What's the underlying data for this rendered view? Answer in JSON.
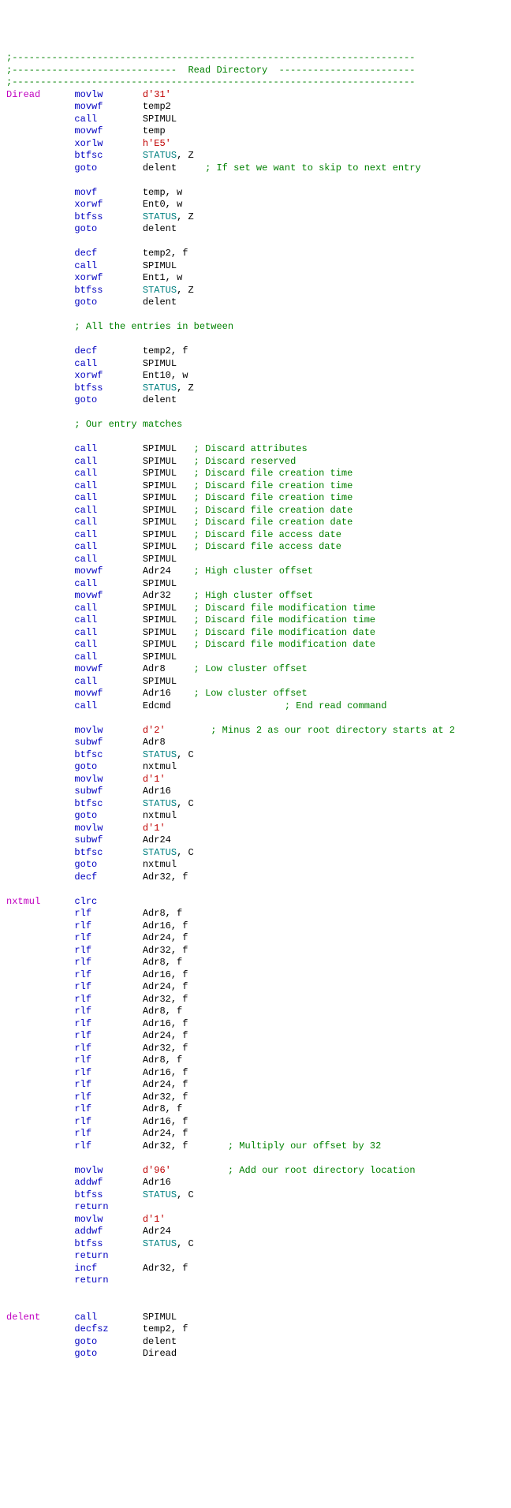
{
  "lines": [
    {
      "type": "comment",
      "text": ";-----------------------------------------------------------------------"
    },
    {
      "type": "comment",
      "text": ";-----------------------------  Read Directory  ------------------------"
    },
    {
      "type": "comment",
      "text": ";-----------------------------------------------------------------------"
    },
    {
      "label": "Diread",
      "mnemonic": "movlw",
      "operands": [
        {
          "cls": "lit",
          "text": "d'31'"
        }
      ]
    },
    {
      "mnemonic": "movwf",
      "operands": [
        {
          "cls": "pln",
          "text": "temp2"
        }
      ]
    },
    {
      "mnemonic": "call",
      "operands": [
        {
          "cls": "pln",
          "text": "SPIMUL"
        }
      ]
    },
    {
      "mnemonic": "movwf",
      "operands": [
        {
          "cls": "pln",
          "text": "temp"
        }
      ]
    },
    {
      "mnemonic": "xorlw",
      "operands": [
        {
          "cls": "lit",
          "text": "h'E5'"
        }
      ]
    },
    {
      "mnemonic": "btfsc",
      "operands": [
        {
          "cls": "reg",
          "text": "STATUS"
        },
        {
          "cls": "pln",
          "text": ", "
        },
        {
          "cls": "pln",
          "text": "Z"
        }
      ]
    },
    {
      "mnemonic": "goto",
      "operands": [
        {
          "cls": "pln",
          "text": "delent"
        }
      ],
      "comment": "     ; If set we want to skip to next entry"
    },
    {
      "type": "blank"
    },
    {
      "mnemonic": "movf",
      "operands": [
        {
          "cls": "pln",
          "text": "temp, w"
        }
      ]
    },
    {
      "mnemonic": "xorwf",
      "operands": [
        {
          "cls": "pln",
          "text": "Ent0, w"
        }
      ]
    },
    {
      "mnemonic": "btfss",
      "operands": [
        {
          "cls": "reg",
          "text": "STATUS"
        },
        {
          "cls": "pln",
          "text": ", "
        },
        {
          "cls": "pln",
          "text": "Z"
        }
      ]
    },
    {
      "mnemonic": "goto",
      "operands": [
        {
          "cls": "pln",
          "text": "delent"
        }
      ]
    },
    {
      "type": "blank"
    },
    {
      "mnemonic": "decf",
      "operands": [
        {
          "cls": "pln",
          "text": "temp2, f"
        }
      ]
    },
    {
      "mnemonic": "call",
      "operands": [
        {
          "cls": "pln",
          "text": "SPIMUL"
        }
      ]
    },
    {
      "mnemonic": "xorwf",
      "operands": [
        {
          "cls": "pln",
          "text": "Ent1, w"
        }
      ]
    },
    {
      "mnemonic": "btfss",
      "operands": [
        {
          "cls": "reg",
          "text": "STATUS"
        },
        {
          "cls": "pln",
          "text": ", "
        },
        {
          "cls": "pln",
          "text": "Z"
        }
      ]
    },
    {
      "mnemonic": "goto",
      "operands": [
        {
          "cls": "pln",
          "text": "delent"
        }
      ]
    },
    {
      "type": "blank"
    },
    {
      "type": "comment",
      "text": "            ; All the entries in between"
    },
    {
      "type": "blank"
    },
    {
      "mnemonic": "decf",
      "operands": [
        {
          "cls": "pln",
          "text": "temp2, f"
        }
      ]
    },
    {
      "mnemonic": "call",
      "operands": [
        {
          "cls": "pln",
          "text": "SPIMUL"
        }
      ]
    },
    {
      "mnemonic": "xorwf",
      "operands": [
        {
          "cls": "pln",
          "text": "Ent10, w"
        }
      ]
    },
    {
      "mnemonic": "btfss",
      "operands": [
        {
          "cls": "reg",
          "text": "STATUS"
        },
        {
          "cls": "pln",
          "text": ", "
        },
        {
          "cls": "pln",
          "text": "Z"
        }
      ]
    },
    {
      "mnemonic": "goto",
      "operands": [
        {
          "cls": "pln",
          "text": "delent"
        }
      ]
    },
    {
      "type": "blank"
    },
    {
      "type": "comment",
      "text": "            ; Our entry matches"
    },
    {
      "type": "blank"
    },
    {
      "mnemonic": "call",
      "operands": [
        {
          "cls": "pln",
          "text": "SPIMUL"
        }
      ],
      "comment": "   ; Discard attributes"
    },
    {
      "mnemonic": "call",
      "operands": [
        {
          "cls": "pln",
          "text": "SPIMUL"
        }
      ],
      "comment": "   ; Discard reserved"
    },
    {
      "mnemonic": "call",
      "operands": [
        {
          "cls": "pln",
          "text": "SPIMUL"
        }
      ],
      "comment": "   ; Discard file creation time"
    },
    {
      "mnemonic": "call",
      "operands": [
        {
          "cls": "pln",
          "text": "SPIMUL"
        }
      ],
      "comment": "   ; Discard file creation time"
    },
    {
      "mnemonic": "call",
      "operands": [
        {
          "cls": "pln",
          "text": "SPIMUL"
        }
      ],
      "comment": "   ; Discard file creation time"
    },
    {
      "mnemonic": "call",
      "operands": [
        {
          "cls": "pln",
          "text": "SPIMUL"
        }
      ],
      "comment": "   ; Discard file creation date"
    },
    {
      "mnemonic": "call",
      "operands": [
        {
          "cls": "pln",
          "text": "SPIMUL"
        }
      ],
      "comment": "   ; Discard file creation date"
    },
    {
      "mnemonic": "call",
      "operands": [
        {
          "cls": "pln",
          "text": "SPIMUL"
        }
      ],
      "comment": "   ; Discard file access date"
    },
    {
      "mnemonic": "call",
      "operands": [
        {
          "cls": "pln",
          "text": "SPIMUL"
        }
      ],
      "comment": "   ; Discard file access date"
    },
    {
      "mnemonic": "call",
      "operands": [
        {
          "cls": "pln",
          "text": "SPIMUL"
        }
      ]
    },
    {
      "mnemonic": "movwf",
      "operands": [
        {
          "cls": "pln",
          "text": "Adr24"
        }
      ],
      "comment": "    ; High cluster offset"
    },
    {
      "mnemonic": "call",
      "operands": [
        {
          "cls": "pln",
          "text": "SPIMUL"
        }
      ]
    },
    {
      "mnemonic": "movwf",
      "operands": [
        {
          "cls": "pln",
          "text": "Adr32"
        }
      ],
      "comment": "    ; High cluster offset"
    },
    {
      "mnemonic": "call",
      "operands": [
        {
          "cls": "pln",
          "text": "SPIMUL"
        }
      ],
      "comment": "   ; Discard file modification time"
    },
    {
      "mnemonic": "call",
      "operands": [
        {
          "cls": "pln",
          "text": "SPIMUL"
        }
      ],
      "comment": "   ; Discard file modification time"
    },
    {
      "mnemonic": "call",
      "operands": [
        {
          "cls": "pln",
          "text": "SPIMUL"
        }
      ],
      "comment": "   ; Discard file modification date"
    },
    {
      "mnemonic": "call",
      "operands": [
        {
          "cls": "pln",
          "text": "SPIMUL"
        }
      ],
      "comment": "   ; Discard file modification date"
    },
    {
      "mnemonic": "call",
      "operands": [
        {
          "cls": "pln",
          "text": "SPIMUL"
        }
      ]
    },
    {
      "mnemonic": "movwf",
      "operands": [
        {
          "cls": "pln",
          "text": "Adr8"
        }
      ],
      "comment": "     ; Low cluster offset"
    },
    {
      "mnemonic": "call",
      "operands": [
        {
          "cls": "pln",
          "text": "SPIMUL"
        }
      ]
    },
    {
      "mnemonic": "movwf",
      "operands": [
        {
          "cls": "pln",
          "text": "Adr16"
        }
      ],
      "comment": "    ; Low cluster offset"
    },
    {
      "mnemonic": "call",
      "operands": [
        {
          "cls": "pln",
          "text": "Edcmd"
        }
      ],
      "comment": "                    ; End read command"
    },
    {
      "type": "blank"
    },
    {
      "mnemonic": "movlw",
      "operands": [
        {
          "cls": "lit",
          "text": "d'2'"
        }
      ],
      "comment": "        ; Minus 2 as our root directory starts at 2"
    },
    {
      "mnemonic": "subwf",
      "operands": [
        {
          "cls": "pln",
          "text": "Adr8"
        }
      ]
    },
    {
      "mnemonic": "btfsc",
      "operands": [
        {
          "cls": "reg",
          "text": "STATUS"
        },
        {
          "cls": "pln",
          "text": ", "
        },
        {
          "cls": "pln",
          "text": "C"
        }
      ]
    },
    {
      "mnemonic": "goto",
      "operands": [
        {
          "cls": "pln",
          "text": "nxtmul"
        }
      ]
    },
    {
      "mnemonic": "movlw",
      "operands": [
        {
          "cls": "lit",
          "text": "d'1'"
        }
      ]
    },
    {
      "mnemonic": "subwf",
      "operands": [
        {
          "cls": "pln",
          "text": "Adr16"
        }
      ]
    },
    {
      "mnemonic": "btfsc",
      "operands": [
        {
          "cls": "reg",
          "text": "STATUS"
        },
        {
          "cls": "pln",
          "text": ", "
        },
        {
          "cls": "pln",
          "text": "C"
        }
      ]
    },
    {
      "mnemonic": "goto",
      "operands": [
        {
          "cls": "pln",
          "text": "nxtmul"
        }
      ]
    },
    {
      "mnemonic": "movlw",
      "operands": [
        {
          "cls": "lit",
          "text": "d'1'"
        }
      ]
    },
    {
      "mnemonic": "subwf",
      "operands": [
        {
          "cls": "pln",
          "text": "Adr24"
        }
      ]
    },
    {
      "mnemonic": "btfsc",
      "operands": [
        {
          "cls": "reg",
          "text": "STATUS"
        },
        {
          "cls": "pln",
          "text": ", "
        },
        {
          "cls": "pln",
          "text": "C"
        }
      ]
    },
    {
      "mnemonic": "goto",
      "operands": [
        {
          "cls": "pln",
          "text": "nxtmul"
        }
      ]
    },
    {
      "mnemonic": "decf",
      "operands": [
        {
          "cls": "pln",
          "text": "Adr32, f"
        }
      ]
    },
    {
      "type": "blank"
    },
    {
      "label": "nxtmul",
      "mnemonic": "clrc"
    },
    {
      "mnemonic": "rlf",
      "operands": [
        {
          "cls": "pln",
          "text": "Adr8, f"
        }
      ]
    },
    {
      "mnemonic": "rlf",
      "operands": [
        {
          "cls": "pln",
          "text": "Adr16, f"
        }
      ]
    },
    {
      "mnemonic": "rlf",
      "operands": [
        {
          "cls": "pln",
          "text": "Adr24, f"
        }
      ]
    },
    {
      "mnemonic": "rlf",
      "operands": [
        {
          "cls": "pln",
          "text": "Adr32, f"
        }
      ]
    },
    {
      "mnemonic": "rlf",
      "operands": [
        {
          "cls": "pln",
          "text": "Adr8, f"
        }
      ]
    },
    {
      "mnemonic": "rlf",
      "operands": [
        {
          "cls": "pln",
          "text": "Adr16, f"
        }
      ]
    },
    {
      "mnemonic": "rlf",
      "operands": [
        {
          "cls": "pln",
          "text": "Adr24, f"
        }
      ]
    },
    {
      "mnemonic": "rlf",
      "operands": [
        {
          "cls": "pln",
          "text": "Adr32, f"
        }
      ]
    },
    {
      "mnemonic": "rlf",
      "operands": [
        {
          "cls": "pln",
          "text": "Adr8, f"
        }
      ]
    },
    {
      "mnemonic": "rlf",
      "operands": [
        {
          "cls": "pln",
          "text": "Adr16, f"
        }
      ]
    },
    {
      "mnemonic": "rlf",
      "operands": [
        {
          "cls": "pln",
          "text": "Adr24, f"
        }
      ]
    },
    {
      "mnemonic": "rlf",
      "operands": [
        {
          "cls": "pln",
          "text": "Adr32, f"
        }
      ]
    },
    {
      "mnemonic": "rlf",
      "operands": [
        {
          "cls": "pln",
          "text": "Adr8, f"
        }
      ]
    },
    {
      "mnemonic": "rlf",
      "operands": [
        {
          "cls": "pln",
          "text": "Adr16, f"
        }
      ]
    },
    {
      "mnemonic": "rlf",
      "operands": [
        {
          "cls": "pln",
          "text": "Adr24, f"
        }
      ]
    },
    {
      "mnemonic": "rlf",
      "operands": [
        {
          "cls": "pln",
          "text": "Adr32, f"
        }
      ]
    },
    {
      "mnemonic": "rlf",
      "operands": [
        {
          "cls": "pln",
          "text": "Adr8, f"
        }
      ]
    },
    {
      "mnemonic": "rlf",
      "operands": [
        {
          "cls": "pln",
          "text": "Adr16, f"
        }
      ]
    },
    {
      "mnemonic": "rlf",
      "operands": [
        {
          "cls": "pln",
          "text": "Adr24, f"
        }
      ]
    },
    {
      "mnemonic": "rlf",
      "operands": [
        {
          "cls": "pln",
          "text": "Adr32, f"
        }
      ],
      "comment": "       ; Multiply our offset by 32"
    },
    {
      "type": "blank"
    },
    {
      "mnemonic": "movlw",
      "operands": [
        {
          "cls": "lit",
          "text": "d'96'"
        }
      ],
      "comment": "          ; Add our root directory location"
    },
    {
      "mnemonic": "addwf",
      "operands": [
        {
          "cls": "pln",
          "text": "Adr16"
        }
      ]
    },
    {
      "mnemonic": "btfss",
      "operands": [
        {
          "cls": "reg",
          "text": "STATUS"
        },
        {
          "cls": "pln",
          "text": ", "
        },
        {
          "cls": "pln",
          "text": "C"
        }
      ]
    },
    {
      "mnemonic": "return"
    },
    {
      "mnemonic": "movlw",
      "operands": [
        {
          "cls": "lit",
          "text": "d'1'"
        }
      ]
    },
    {
      "mnemonic": "addwf",
      "operands": [
        {
          "cls": "pln",
          "text": "Adr24"
        }
      ]
    },
    {
      "mnemonic": "btfss",
      "operands": [
        {
          "cls": "reg",
          "text": "STATUS"
        },
        {
          "cls": "pln",
          "text": ", "
        },
        {
          "cls": "pln",
          "text": "C"
        }
      ]
    },
    {
      "mnemonic": "return"
    },
    {
      "mnemonic": "incf",
      "operands": [
        {
          "cls": "pln",
          "text": "Adr32, f"
        }
      ]
    },
    {
      "mnemonic": "return"
    },
    {
      "type": "blank"
    },
    {
      "type": "blank"
    },
    {
      "label": "delent",
      "mnemonic": "call",
      "operands": [
        {
          "cls": "pln",
          "text": "SPIMUL"
        }
      ]
    },
    {
      "mnemonic": "decfsz",
      "operands": [
        {
          "cls": "pln",
          "text": "temp2, f"
        }
      ]
    },
    {
      "mnemonic": "goto",
      "operands": [
        {
          "cls": "pln",
          "text": "delent"
        }
      ]
    },
    {
      "mnemonic": "goto",
      "operands": [
        {
          "cls": "pln",
          "text": "Diread"
        }
      ]
    }
  ]
}
